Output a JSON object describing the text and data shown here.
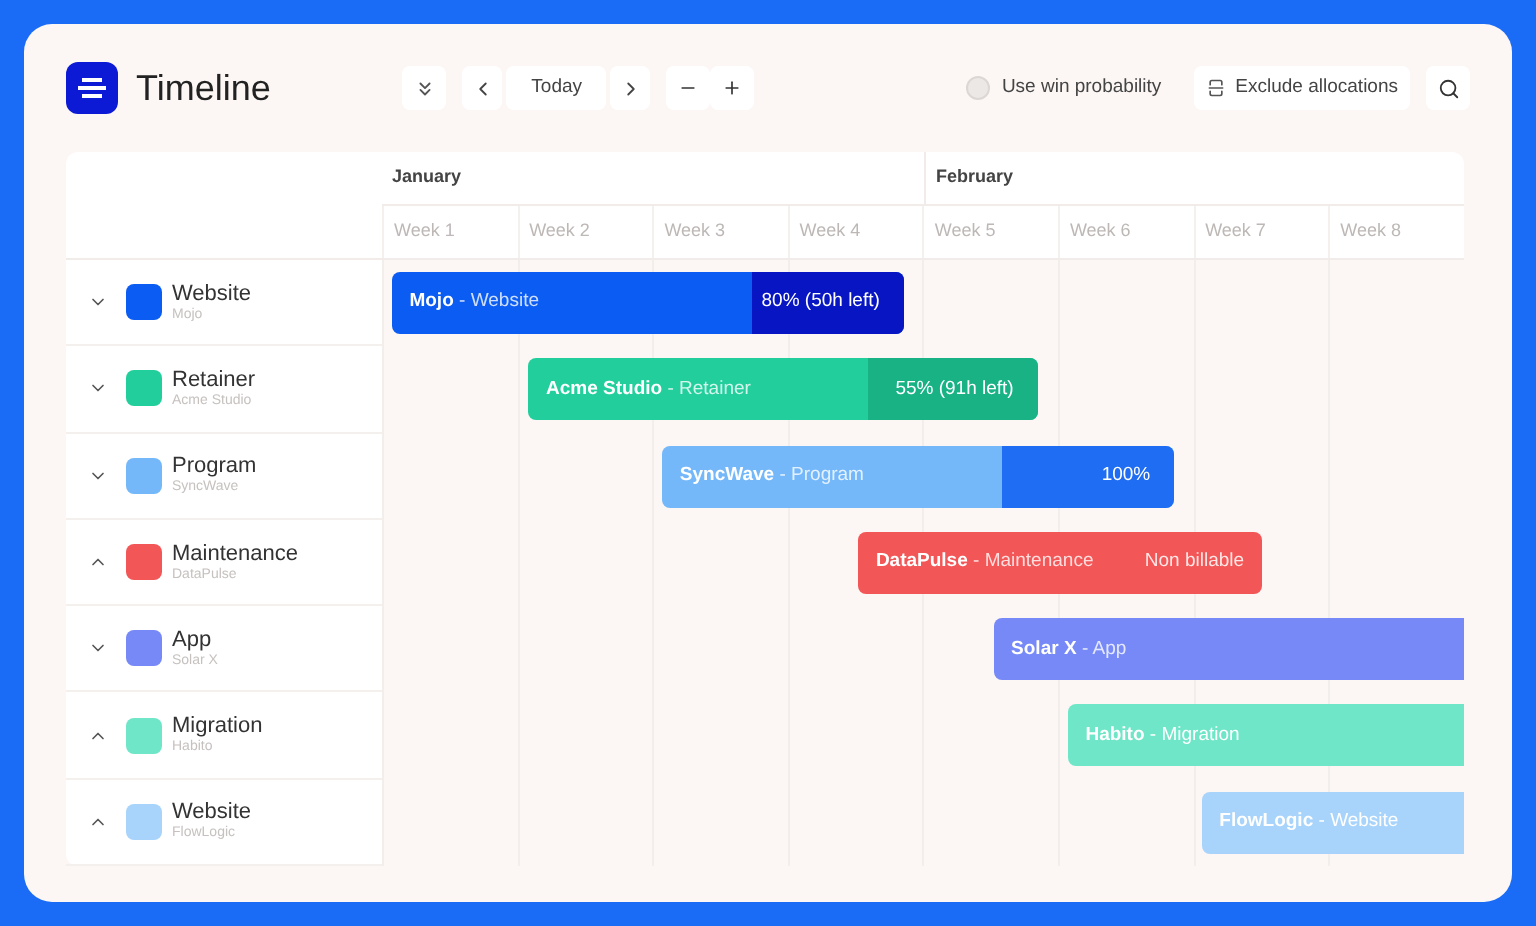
{
  "header": {
    "title": "Timeline"
  },
  "toolbar": {
    "today": "Today",
    "win_probability": {
      "label": "Use win probability",
      "on": false
    },
    "exclude": "Exclude allocations"
  },
  "months": [
    "January",
    "February"
  ],
  "weeks": [
    "Week 1",
    "Week 2",
    "Week 3",
    "Week 4",
    "Week 5",
    "Week 6",
    "Week 7",
    "Week 8"
  ],
  "rows": [
    {
      "name": "Website",
      "client": "Mojo",
      "expanded": false,
      "color": "#0b5cf2",
      "bar": {
        "client": "Mojo",
        "separator": "-",
        "project": "Website",
        "kind": "progress",
        "progress": "80% (50h left)",
        "segment": {
          "color": "#0716c2"
        }
      }
    },
    {
      "name": "Retainer",
      "client": "Acme Studio",
      "expanded": false,
      "color": "#22cf9c",
      "bar": {
        "client": "Acme Studio",
        "separator": "-",
        "project": "Retainer",
        "kind": "progress",
        "progress": "55% (91h left)",
        "segment": {
          "color": "#18b285"
        }
      }
    },
    {
      "name": "Program",
      "client": "SyncWave",
      "expanded": false,
      "color": "#74b8fa",
      "bar": {
        "client": "SyncWave",
        "separator": "-",
        "project": "Program",
        "kind": "progress",
        "progress": "100%",
        "segment": {
          "color": "#1f6df2"
        }
      }
    },
    {
      "name": "Maintenance",
      "client": "DataPulse",
      "expanded": true,
      "color": "#f35656",
      "bar": {
        "client": "DataPulse",
        "separator": "-",
        "project": "Maintenance",
        "kind": "tag",
        "progress": "Non billable"
      }
    },
    {
      "name": "App",
      "client": "Solar X",
      "expanded": false,
      "color": "#7689f7",
      "bar": {
        "client": "Solar X",
        "separator": "-",
        "project": "App",
        "kind": "plain"
      }
    },
    {
      "name": "Migration",
      "client": "Habito",
      "expanded": true,
      "color": "#6fe6c8",
      "bar": {
        "client": "Habito",
        "separator": "-",
        "project": "Migration",
        "kind": "plain"
      }
    },
    {
      "name": "Website",
      "client": "FlowLogic",
      "expanded": true,
      "color": "#a8d4fb",
      "bar": {
        "client": "FlowLogic",
        "separator": "-",
        "project": "Website",
        "kind": "plain"
      }
    }
  ]
}
